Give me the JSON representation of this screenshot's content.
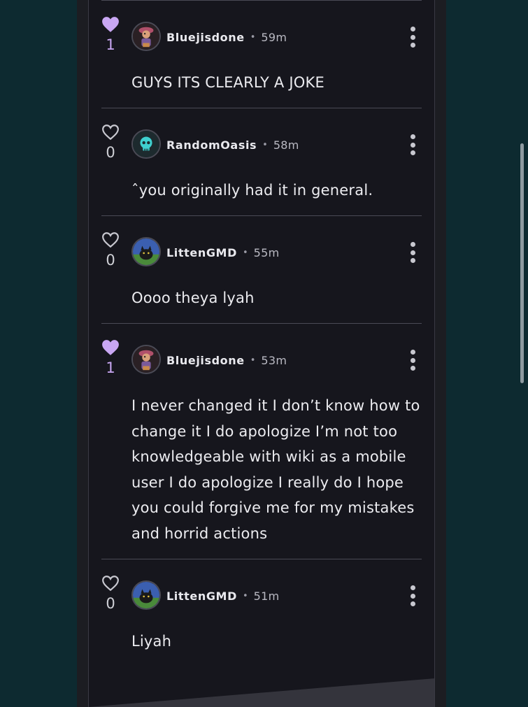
{
  "colors": {
    "page_background": "#0d2a30",
    "panel_background": "#16161d",
    "liked_heart": "#c9a7f3",
    "divider": "#4a4a55"
  },
  "comments": [
    {
      "username": "Bluejisdone",
      "time": "59m",
      "likes": "1",
      "liked": true,
      "avatar_icon": "pirate-character-avatar-icon",
      "text": "GUYS ITS CLEARLY A JOKE"
    },
    {
      "username": "RandomOasis",
      "time": "58m",
      "likes": "0",
      "liked": false,
      "avatar_icon": "skull-avatar-icon",
      "text": "ˆyou originally had it in general."
    },
    {
      "username": "LittenGMD",
      "time": "55m",
      "likes": "0",
      "liked": false,
      "avatar_icon": "black-cat-avatar-icon",
      "text": "Oooo theya lyah"
    },
    {
      "username": "Bluejisdone",
      "time": "53m",
      "likes": "1",
      "liked": true,
      "avatar_icon": "pirate-character-avatar-icon",
      "text": "I never changed it I don’t know how to change it I do apologize I’m not too knowledgeable with wiki as a mobile user I do apologize I really do I hope you could forgive me for my mistakes and horrid actions"
    },
    {
      "username": "LittenGMD",
      "time": "51m",
      "likes": "0",
      "liked": false,
      "avatar_icon": "black-cat-avatar-icon",
      "text": "Liyah"
    }
  ],
  "separator_dot": "•"
}
